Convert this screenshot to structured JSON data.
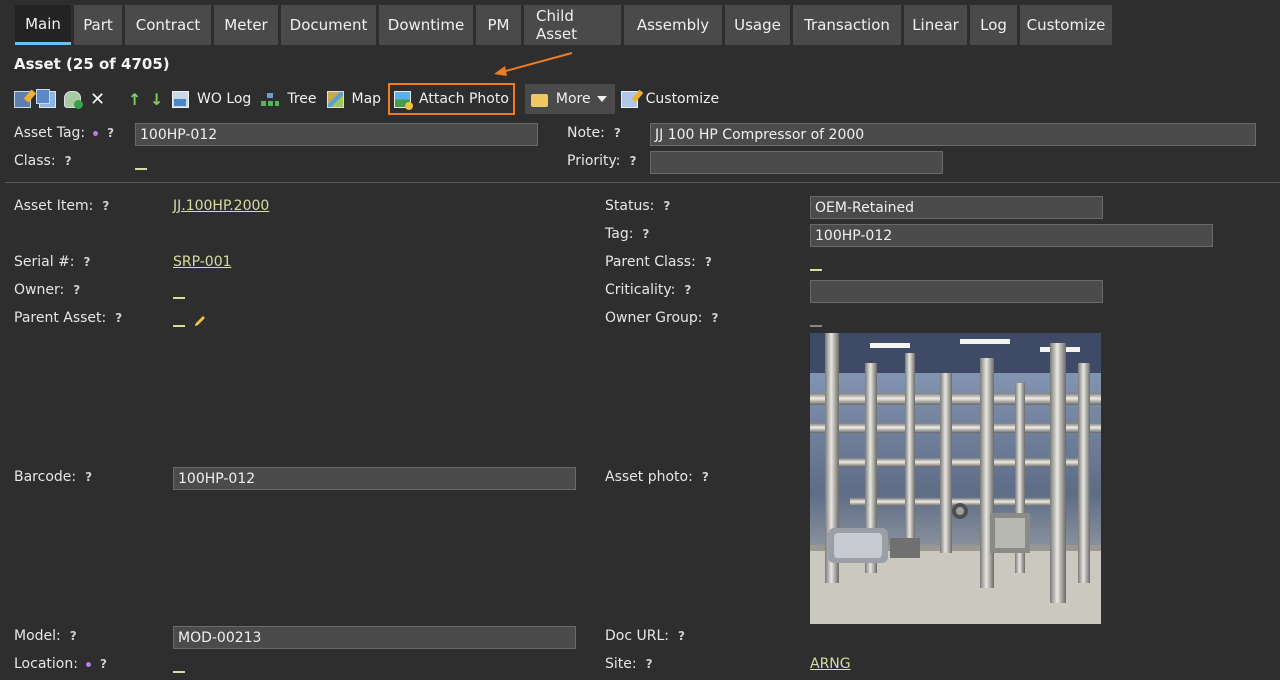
{
  "tabs": [
    "Main",
    "Part",
    "Contract",
    "Meter",
    "Document",
    "Downtime",
    "PM",
    "Child Asset",
    "Assembly",
    "Usage",
    "Transaction",
    "Linear",
    "Log",
    "Customize"
  ],
  "title": "Asset (25 of 4705)",
  "toolbar": {
    "wo_log": "WO Log",
    "tree": "Tree",
    "map": "Map",
    "attach_photo": "Attach Photo",
    "more": "More",
    "customize": "Customize",
    "highlight_color": "#f07b22"
  },
  "help_mark": "?",
  "header_fields": {
    "asset_tag": {
      "label": "Asset Tag:",
      "value": "100HP-012"
    },
    "class": {
      "label": "Class:"
    },
    "note": {
      "label": "Note:",
      "value": "JJ 100 HP Compressor of 2000"
    },
    "priority": {
      "label": "Priority:",
      "value": ""
    }
  },
  "fields": {
    "asset_item": {
      "label": "Asset Item:",
      "value": "JJ.100HP.2000"
    },
    "serial": {
      "label": "Serial #:",
      "value": "SRP-001"
    },
    "owner": {
      "label": "Owner:"
    },
    "parent_asset": {
      "label": "Parent Asset:"
    },
    "barcode": {
      "label": "Barcode:",
      "value": "100HP-012"
    },
    "model": {
      "label": "Model:",
      "value": "MOD-00213"
    },
    "location": {
      "label": "Location:"
    },
    "status": {
      "label": "Status:",
      "value": "OEM-Retained"
    },
    "tag": {
      "label": "Tag:",
      "value": "100HP-012"
    },
    "parent_class": {
      "label": "Parent Class:"
    },
    "criticality": {
      "label": "Criticality:",
      "value": ""
    },
    "owner_group": {
      "label": "Owner Group:"
    },
    "asset_photo": {
      "label": "Asset photo:"
    },
    "doc_url": {
      "label": "Doc URL:"
    },
    "site": {
      "label": "Site:",
      "value": "ARNG"
    }
  },
  "colors": {
    "background": "#2e2e2e",
    "tab": "#4a4a4a",
    "active_tab_accent": "#6cc3ea",
    "link": "#d8dca0",
    "required_dot": "#b77ee8"
  }
}
